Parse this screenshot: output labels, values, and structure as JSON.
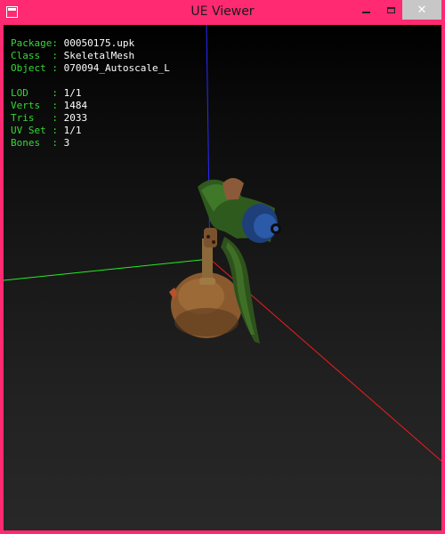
{
  "window": {
    "title": "UE Viewer",
    "buttons": {
      "minimize": "minimize",
      "maximize": "maximize",
      "close": "✕"
    }
  },
  "info_panel": {
    "rows_a": [
      {
        "key": "Package:",
        "value": "00050175.upk"
      },
      {
        "key": "Class  :",
        "value": "SkeletalMesh"
      },
      {
        "key": "Object :",
        "value": "070094_Autoscale_L"
      }
    ],
    "rows_b": [
      {
        "key": "LOD    :",
        "value": "1/1"
      },
      {
        "key": "Verts  :",
        "value": "1484"
      },
      {
        "key": "Tris   :",
        "value": "2033"
      },
      {
        "key": "UV Set :",
        "value": "1/1"
      },
      {
        "key": "Bones  :",
        "value": "3"
      }
    ]
  },
  "colors": {
    "titlebar": "#ff2a72",
    "label_text": "#36d836",
    "value_text": "#ffffff",
    "axis_x": "#ff2020",
    "axis_y": "#20ff20",
    "axis_z": "#2020ff"
  },
  "viewport": {
    "model": "spray-gun-mesh"
  }
}
